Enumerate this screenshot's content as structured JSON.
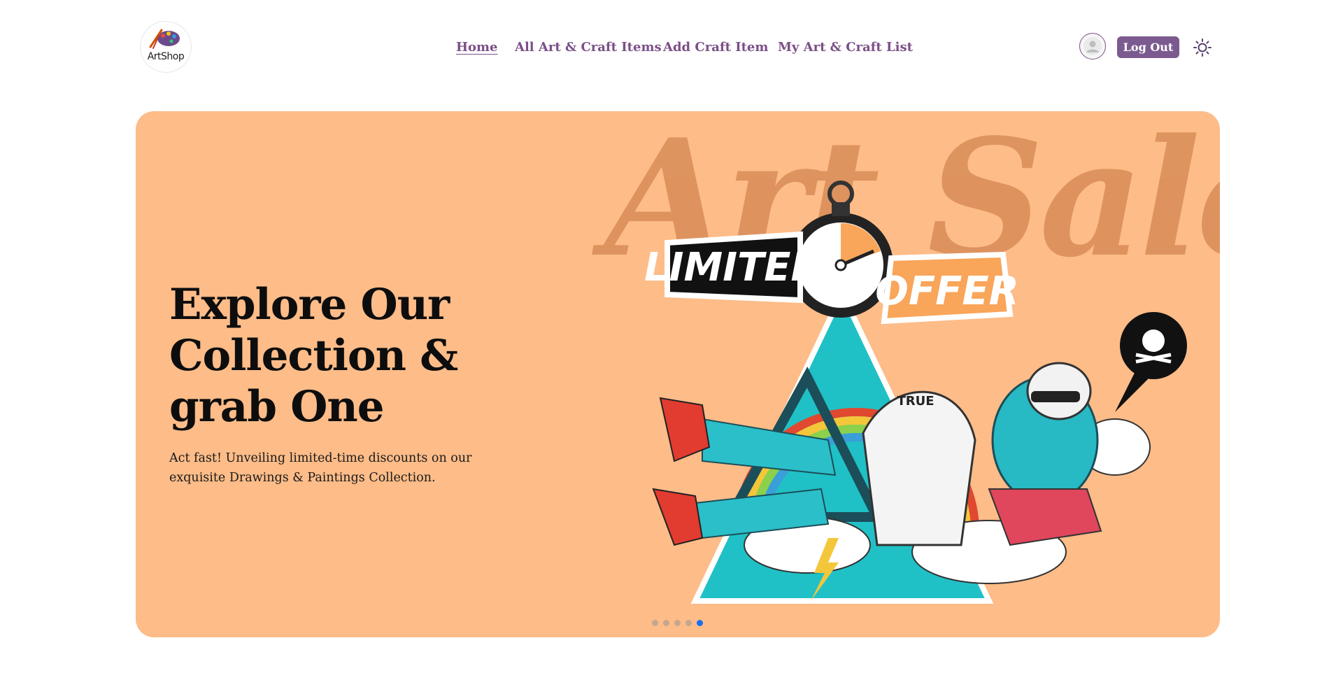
{
  "brand": {
    "logo_text": "ArtShop"
  },
  "nav": {
    "items": [
      {
        "label": "Home",
        "active": true
      },
      {
        "label": "All Art & Craft Items",
        "active": false
      },
      {
        "label": "Add Craft Item",
        "active": false
      },
      {
        "label": "My Art & Craft List",
        "active": false
      }
    ]
  },
  "user": {
    "avatar_icon": "user-avatar-icon",
    "logout_label": "Log Out"
  },
  "theme": {
    "toggle_icon": "sun-icon"
  },
  "hero": {
    "title": "Explore Our Collection & grab One",
    "description": "Act fast! Unveiling limited-time discounts on our exquisite Drawings & Paintings Collection.",
    "image": {
      "watermark_text": "Art Sale",
      "badge_left": "LIMITED",
      "badge_right": "OFFER",
      "hand_text": "TRUE"
    },
    "carousel": {
      "slides": 5,
      "active_index": 4
    }
  },
  "colors": {
    "accent": "#7b4f87",
    "button": "#7b5b8f",
    "hero_bg": "#fdbc88",
    "dot_active": "#1a6ef2",
    "dot_inactive": "#c4a791"
  }
}
